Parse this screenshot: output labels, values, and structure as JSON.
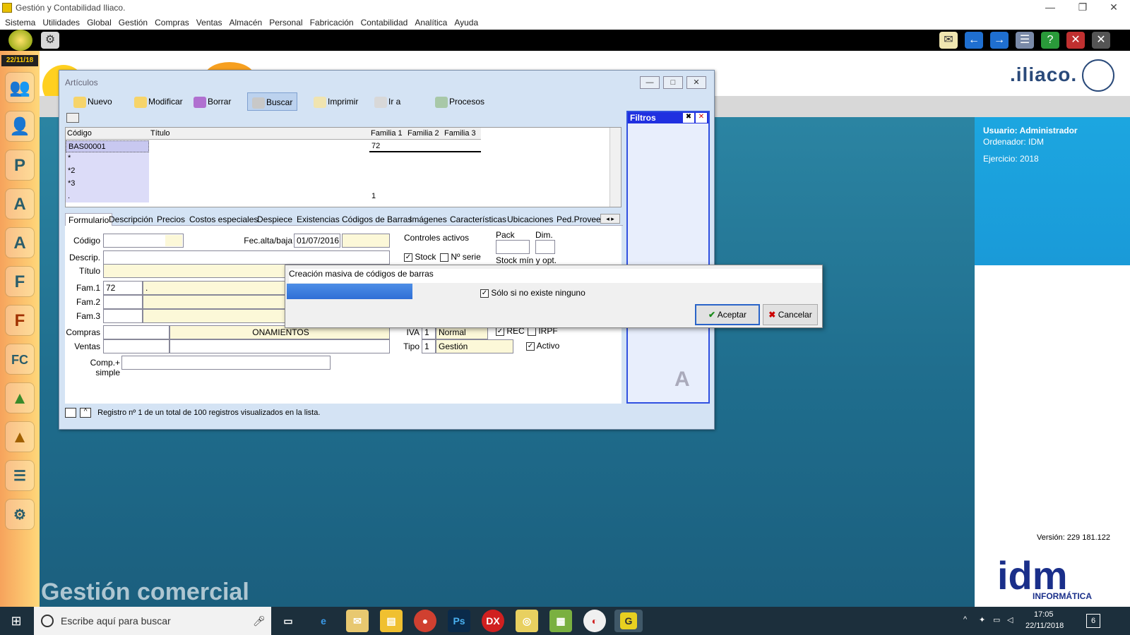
{
  "window": {
    "title": "Gestión y Contabilidad Iliaco.",
    "controls": [
      "—",
      "❐",
      "✕"
    ]
  },
  "menu": [
    "Sistema",
    "Utilidades",
    "Global",
    "Gestión",
    "Compras",
    "Ventas",
    "Almacén",
    "Personal",
    "Fabricación",
    "Contabilidad",
    "Analítica",
    "Ayuda"
  ],
  "leftbar": {
    "date": "22/11/18"
  },
  "brand": {
    "iliaco": ".iliaco.",
    "gestion": "Gestión comercial",
    "idm": "idm",
    "idm_sub": "INFORMÁTICA"
  },
  "session": {
    "usuario": "Usuario: Administrador",
    "ordenador": "Ordenador: IDM",
    "ejercicio": "Ejercicio: 2018",
    "version": "Versión: 229 181.122"
  },
  "articulos": {
    "title": "Artículos",
    "toolbar": [
      "Nuevo",
      "Modificar",
      "Borrar",
      "Buscar",
      "Imprimir",
      "Ir a",
      "Procesos"
    ],
    "grid_headers": [
      "Código",
      "Título",
      "Familia 1",
      "Familia 2",
      "Familia 3"
    ],
    "rows": [
      {
        "codigo": "BAS00001",
        "titulo": "",
        "fam1": "72"
      },
      {
        "codigo": "*",
        "titulo": "",
        "fam1": ""
      },
      {
        "codigo": "*2",
        "titulo": "",
        "fam1": ""
      },
      {
        "codigo": "*3",
        "titulo": "",
        "fam1": ""
      },
      {
        "codigo": ".",
        "titulo": "",
        "fam1": "1"
      }
    ],
    "filtros": "Filtros",
    "tabs": [
      "Formulario",
      "Descripción",
      "Precios",
      "Costos especiales",
      "Despiece",
      "Existencias",
      "Códigos de Barras",
      "Imágenes",
      "Características",
      "Ubicaciones",
      "Ped.Proveec"
    ],
    "form": {
      "codigo_label": "Código",
      "fec_label": "Fec.alta/baja",
      "fec_value": "01/07/2016",
      "controles_label": "Controles activos",
      "stock_label": "Stock",
      "nserie_label": "Nº serie",
      "pack_label": "Pack",
      "dim_label": "Dim.",
      "stockminopt_label": "Stock mín y opt.",
      "descrip_label": "Descrip.",
      "titulo_label": "Título",
      "fam1_label": "Fam.1",
      "fam1_value": "72",
      "fam1_desc": ".",
      "fam2_label": "Fam.2",
      "fam3_label": "Fam.3",
      "compras_label": "Compras",
      "compras_desc": "ONAMIENTOS",
      "ventas_label": "Ventas",
      "iva_label": "IVA",
      "iva_code": "1",
      "iva_value": "Normal",
      "rec_label": "REC",
      "irpf_label": "IRPF",
      "tipo_label": "Tipo",
      "tipo_code": "1",
      "tipo_value": "Gestión",
      "activo_label": "Activo",
      "comp_label": "Comp.+ simple"
    },
    "status": "Registro nº 1 de un total de 100 registros visualizados en la lista."
  },
  "dialog": {
    "title": "Creación masiva de códigos de barras",
    "checkbox": "Sólo si no existe ninguno",
    "accept": "Aceptar",
    "cancel": "Cancelar"
  },
  "taskbar": {
    "search_placeholder": "Escribe aquí para buscar",
    "time": "17:05",
    "date": "22/11/2018",
    "notifications": "6"
  }
}
